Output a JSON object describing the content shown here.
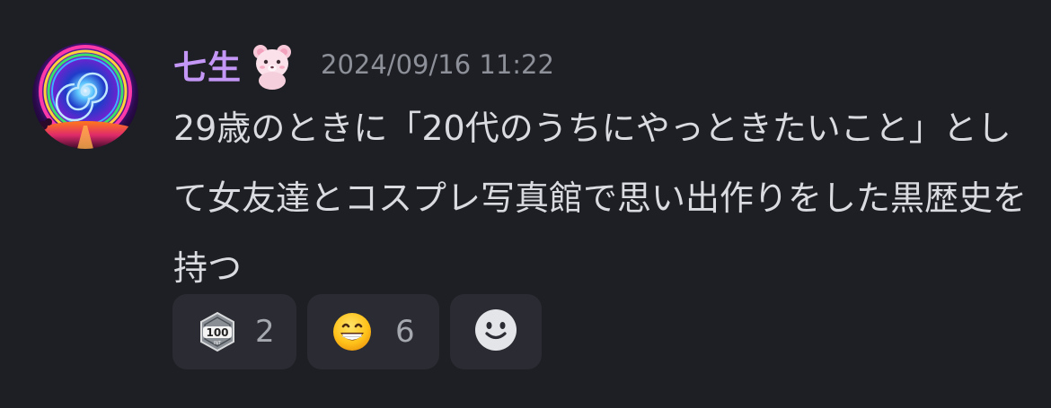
{
  "author": {
    "name": "七生",
    "avatar_icon": "swirl-avatar-icon",
    "role_icon": "pink-bear-icon",
    "name_color": "#c497f7"
  },
  "timestamp": "2024/09/16 11:22",
  "message": {
    "text": "29歳のときに「20代のうちにやっときたいこと」として女友達とコスプレ写真館で思い出作りをした黒歴史を持つ"
  },
  "reactions": [
    {
      "emoji": "100-badge-icon",
      "count": "2"
    },
    {
      "emoji": "grinning-face-icon",
      "count": "6"
    }
  ],
  "add_reaction": {
    "icon": "smiley-add-reaction-icon"
  },
  "colors": {
    "background": "#1e1f24",
    "text": "#dadbe0",
    "muted": "#8e9099",
    "reaction_bg": "#2b2c33"
  }
}
